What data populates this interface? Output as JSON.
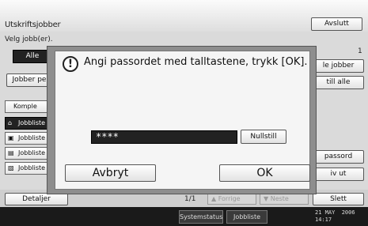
{
  "window": {
    "title": "Utskriftsjobber",
    "close_button": "Avslutt",
    "subtitle": "Velg jobb(er).",
    "selected_filter": "Alle",
    "jobs_button": "Jobber pe",
    "page_number_right": "1"
  },
  "list": {
    "header": "Komple",
    "items": [
      {
        "label": "Jobbliste",
        "icon": "lock-icon"
      },
      {
        "label": "Jobbliste",
        "icon": "print-icon"
      },
      {
        "label": "Jobbliste",
        "icon": "printer-icon"
      },
      {
        "label": "Jobbliste",
        "icon": "sample-icon"
      }
    ],
    "details_button": "Detaljer"
  },
  "right_buttons": {
    "delete_jobs": "le jobber",
    "reset_all": "till alle",
    "password": "passord",
    "print": "iv ut",
    "delete": "Slett"
  },
  "pagination": {
    "page": "1/1",
    "prev": "Forrige",
    "next": "Neste"
  },
  "statusbar": {
    "system_status": "Systemstatus",
    "job_list": "Jobbliste",
    "clock": "21 MAY  2006\n14:17"
  },
  "dialog": {
    "message": "Angi passordet med talltastene, trykk [OK].",
    "password_value": "****",
    "reset_label": "Nullstill",
    "cancel_label": "Avbryt",
    "ok_label": "OK"
  }
}
